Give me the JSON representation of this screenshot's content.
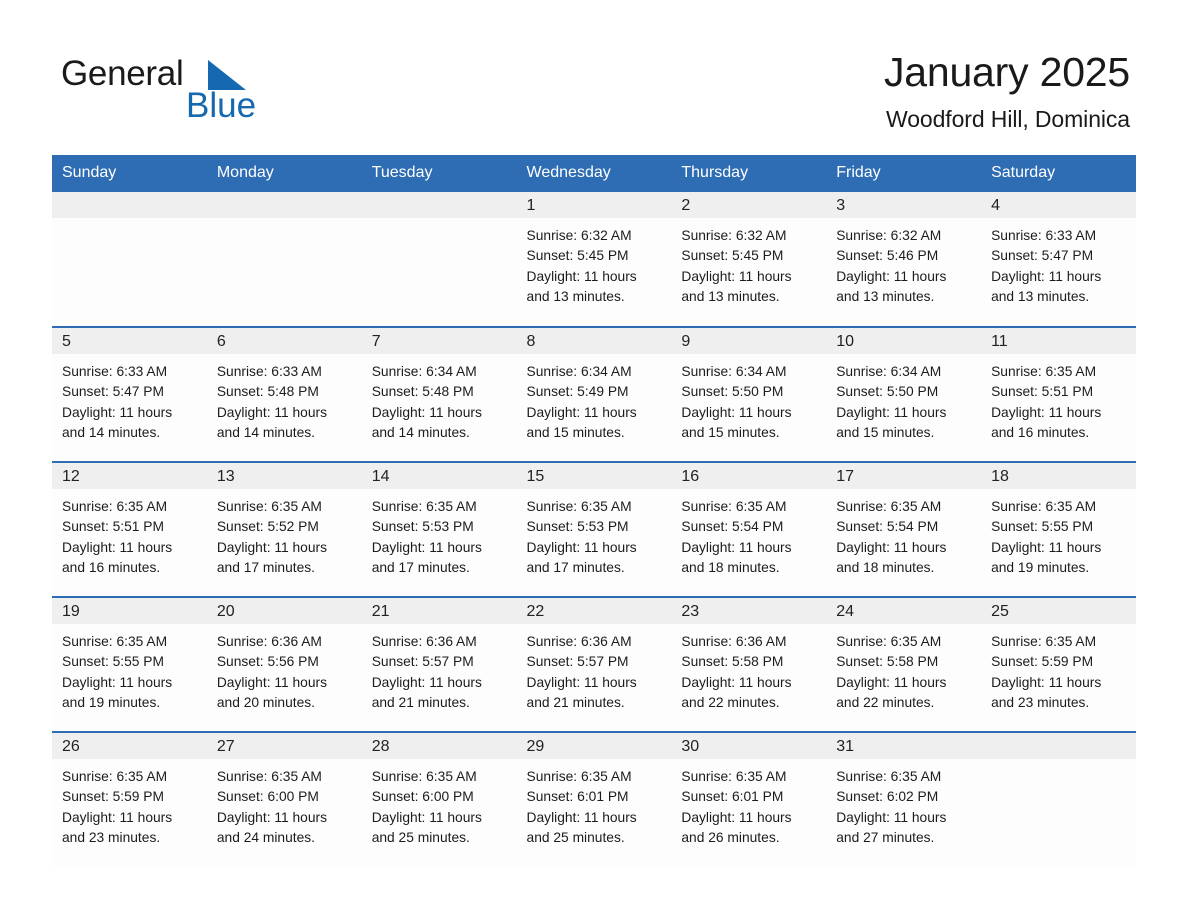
{
  "brand": {
    "name_part1": "General",
    "name_part2": "Blue",
    "logo_icon": "triangle-flag-icon",
    "accent_color": "#1569b0"
  },
  "header": {
    "title": "January 2025",
    "subtitle": "Woodford Hill, Dominica"
  },
  "theme": {
    "header_blue": "#2E6DB4",
    "day_band_gray": "#efefef",
    "text_dark": "#1a1a1a"
  },
  "weekday_headers": [
    "Sunday",
    "Monday",
    "Tuesday",
    "Wednesday",
    "Thursday",
    "Friday",
    "Saturday"
  ],
  "weeks": [
    [
      {
        "blank": true,
        "day": ""
      },
      {
        "blank": true,
        "day": ""
      },
      {
        "blank": true,
        "day": ""
      },
      {
        "blank": false,
        "day": "1",
        "sunrise": "Sunrise: 6:32 AM",
        "sunset": "Sunset: 5:45 PM",
        "daylight_line1": "Daylight: 11 hours",
        "daylight_line2": "and 13 minutes."
      },
      {
        "blank": false,
        "day": "2",
        "sunrise": "Sunrise: 6:32 AM",
        "sunset": "Sunset: 5:45 PM",
        "daylight_line1": "Daylight: 11 hours",
        "daylight_line2": "and 13 minutes."
      },
      {
        "blank": false,
        "day": "3",
        "sunrise": "Sunrise: 6:32 AM",
        "sunset": "Sunset: 5:46 PM",
        "daylight_line1": "Daylight: 11 hours",
        "daylight_line2": "and 13 minutes."
      },
      {
        "blank": false,
        "day": "4",
        "sunrise": "Sunrise: 6:33 AM",
        "sunset": "Sunset: 5:47 PM",
        "daylight_line1": "Daylight: 11 hours",
        "daylight_line2": "and 13 minutes."
      }
    ],
    [
      {
        "blank": false,
        "day": "5",
        "sunrise": "Sunrise: 6:33 AM",
        "sunset": "Sunset: 5:47 PM",
        "daylight_line1": "Daylight: 11 hours",
        "daylight_line2": "and 14 minutes."
      },
      {
        "blank": false,
        "day": "6",
        "sunrise": "Sunrise: 6:33 AM",
        "sunset": "Sunset: 5:48 PM",
        "daylight_line1": "Daylight: 11 hours",
        "daylight_line2": "and 14 minutes."
      },
      {
        "blank": false,
        "day": "7",
        "sunrise": "Sunrise: 6:34 AM",
        "sunset": "Sunset: 5:48 PM",
        "daylight_line1": "Daylight: 11 hours",
        "daylight_line2": "and 14 minutes."
      },
      {
        "blank": false,
        "day": "8",
        "sunrise": "Sunrise: 6:34 AM",
        "sunset": "Sunset: 5:49 PM",
        "daylight_line1": "Daylight: 11 hours",
        "daylight_line2": "and 15 minutes."
      },
      {
        "blank": false,
        "day": "9",
        "sunrise": "Sunrise: 6:34 AM",
        "sunset": "Sunset: 5:50 PM",
        "daylight_line1": "Daylight: 11 hours",
        "daylight_line2": "and 15 minutes."
      },
      {
        "blank": false,
        "day": "10",
        "sunrise": "Sunrise: 6:34 AM",
        "sunset": "Sunset: 5:50 PM",
        "daylight_line1": "Daylight: 11 hours",
        "daylight_line2": "and 15 minutes."
      },
      {
        "blank": false,
        "day": "11",
        "sunrise": "Sunrise: 6:35 AM",
        "sunset": "Sunset: 5:51 PM",
        "daylight_line1": "Daylight: 11 hours",
        "daylight_line2": "and 16 minutes."
      }
    ],
    [
      {
        "blank": false,
        "day": "12",
        "sunrise": "Sunrise: 6:35 AM",
        "sunset": "Sunset: 5:51 PM",
        "daylight_line1": "Daylight: 11 hours",
        "daylight_line2": "and 16 minutes."
      },
      {
        "blank": false,
        "day": "13",
        "sunrise": "Sunrise: 6:35 AM",
        "sunset": "Sunset: 5:52 PM",
        "daylight_line1": "Daylight: 11 hours",
        "daylight_line2": "and 17 minutes."
      },
      {
        "blank": false,
        "day": "14",
        "sunrise": "Sunrise: 6:35 AM",
        "sunset": "Sunset: 5:53 PM",
        "daylight_line1": "Daylight: 11 hours",
        "daylight_line2": "and 17 minutes."
      },
      {
        "blank": false,
        "day": "15",
        "sunrise": "Sunrise: 6:35 AM",
        "sunset": "Sunset: 5:53 PM",
        "daylight_line1": "Daylight: 11 hours",
        "daylight_line2": "and 17 minutes."
      },
      {
        "blank": false,
        "day": "16",
        "sunrise": "Sunrise: 6:35 AM",
        "sunset": "Sunset: 5:54 PM",
        "daylight_line1": "Daylight: 11 hours",
        "daylight_line2": "and 18 minutes."
      },
      {
        "blank": false,
        "day": "17",
        "sunrise": "Sunrise: 6:35 AM",
        "sunset": "Sunset: 5:54 PM",
        "daylight_line1": "Daylight: 11 hours",
        "daylight_line2": "and 18 minutes."
      },
      {
        "blank": false,
        "day": "18",
        "sunrise": "Sunrise: 6:35 AM",
        "sunset": "Sunset: 5:55 PM",
        "daylight_line1": "Daylight: 11 hours",
        "daylight_line2": "and 19 minutes."
      }
    ],
    [
      {
        "blank": false,
        "day": "19",
        "sunrise": "Sunrise: 6:35 AM",
        "sunset": "Sunset: 5:55 PM",
        "daylight_line1": "Daylight: 11 hours",
        "daylight_line2": "and 19 minutes."
      },
      {
        "blank": false,
        "day": "20",
        "sunrise": "Sunrise: 6:36 AM",
        "sunset": "Sunset: 5:56 PM",
        "daylight_line1": "Daylight: 11 hours",
        "daylight_line2": "and 20 minutes."
      },
      {
        "blank": false,
        "day": "21",
        "sunrise": "Sunrise: 6:36 AM",
        "sunset": "Sunset: 5:57 PM",
        "daylight_line1": "Daylight: 11 hours",
        "daylight_line2": "and 21 minutes."
      },
      {
        "blank": false,
        "day": "22",
        "sunrise": "Sunrise: 6:36 AM",
        "sunset": "Sunset: 5:57 PM",
        "daylight_line1": "Daylight: 11 hours",
        "daylight_line2": "and 21 minutes."
      },
      {
        "blank": false,
        "day": "23",
        "sunrise": "Sunrise: 6:36 AM",
        "sunset": "Sunset: 5:58 PM",
        "daylight_line1": "Daylight: 11 hours",
        "daylight_line2": "and 22 minutes."
      },
      {
        "blank": false,
        "day": "24",
        "sunrise": "Sunrise: 6:35 AM",
        "sunset": "Sunset: 5:58 PM",
        "daylight_line1": "Daylight: 11 hours",
        "daylight_line2": "and 22 minutes."
      },
      {
        "blank": false,
        "day": "25",
        "sunrise": "Sunrise: 6:35 AM",
        "sunset": "Sunset: 5:59 PM",
        "daylight_line1": "Daylight: 11 hours",
        "daylight_line2": "and 23 minutes."
      }
    ],
    [
      {
        "blank": false,
        "day": "26",
        "sunrise": "Sunrise: 6:35 AM",
        "sunset": "Sunset: 5:59 PM",
        "daylight_line1": "Daylight: 11 hours",
        "daylight_line2": "and 23 minutes."
      },
      {
        "blank": false,
        "day": "27",
        "sunrise": "Sunrise: 6:35 AM",
        "sunset": "Sunset: 6:00 PM",
        "daylight_line1": "Daylight: 11 hours",
        "daylight_line2": "and 24 minutes."
      },
      {
        "blank": false,
        "day": "28",
        "sunrise": "Sunrise: 6:35 AM",
        "sunset": "Sunset: 6:00 PM",
        "daylight_line1": "Daylight: 11 hours",
        "daylight_line2": "and 25 minutes."
      },
      {
        "blank": false,
        "day": "29",
        "sunrise": "Sunrise: 6:35 AM",
        "sunset": "Sunset: 6:01 PM",
        "daylight_line1": "Daylight: 11 hours",
        "daylight_line2": "and 25 minutes."
      },
      {
        "blank": false,
        "day": "30",
        "sunrise": "Sunrise: 6:35 AM",
        "sunset": "Sunset: 6:01 PM",
        "daylight_line1": "Daylight: 11 hours",
        "daylight_line2": "and 26 minutes."
      },
      {
        "blank": false,
        "day": "31",
        "sunrise": "Sunrise: 6:35 AM",
        "sunset": "Sunset: 6:02 PM",
        "daylight_line1": "Daylight: 11 hours",
        "daylight_line2": "and 27 minutes."
      },
      {
        "blank": true,
        "day": ""
      }
    ]
  ]
}
